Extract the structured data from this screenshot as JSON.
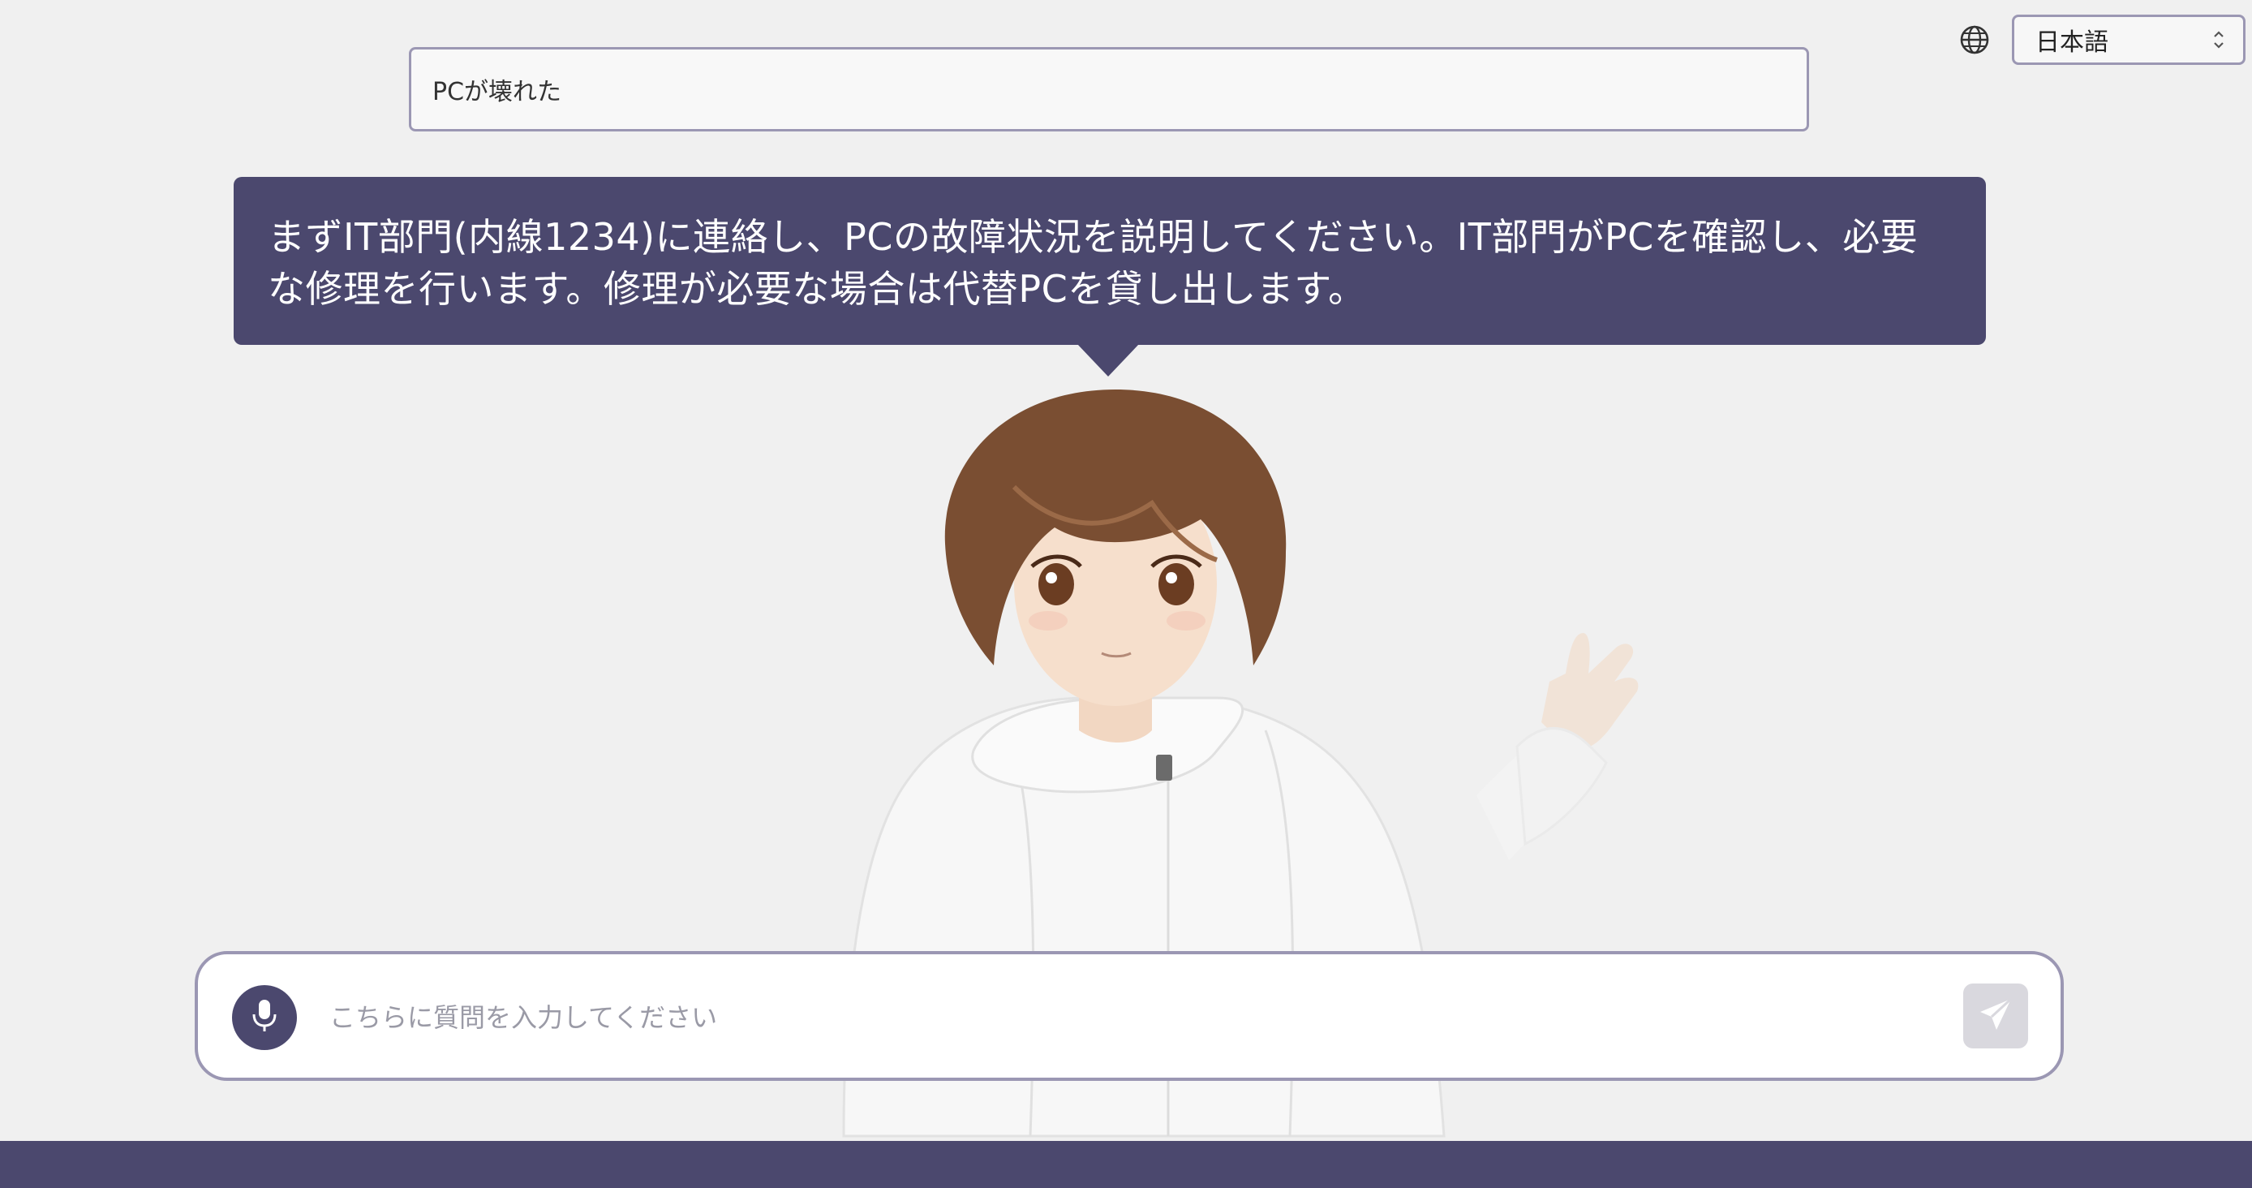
{
  "language_selector": {
    "icon": "globe-icon",
    "selected": "日本語"
  },
  "question_display": {
    "text": "PCが壊れた"
  },
  "answer_bubble": {
    "line1": "まずIT部門(内線1234)に連絡し、PCの故障状況を説明してください。IT部門がPCを確認し、必要",
    "line2": "な修理を行います。修理が必要な場合は代替PCを貸し出します。"
  },
  "input_bar": {
    "placeholder": "こちらに質問を入力してください",
    "mic_icon": "microphone-icon",
    "send_icon": "send-paper-plane-icon"
  },
  "colors": {
    "accent": "#4b486e",
    "background": "#f0f0f0",
    "border": "#9b97b3",
    "send_disabled": "#d9d8de"
  }
}
